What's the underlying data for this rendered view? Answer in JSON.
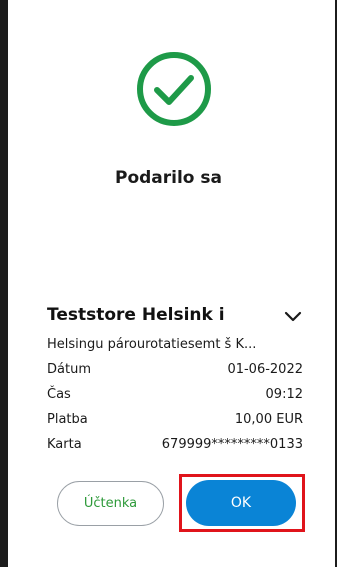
{
  "status": {
    "title": "Podarilo sa",
    "icon": "check-circle-icon",
    "color": "#1e9a48"
  },
  "merchant": {
    "name": "Teststore Helsink i",
    "address": "Helsingu párourotatiesemt š  K..."
  },
  "details": [
    {
      "label": "Dátum",
      "value": "01-06-2022"
    },
    {
      "label": "Čas",
      "value": "09:12"
    },
    {
      "label": "Platba",
      "value": "10,00 EUR"
    },
    {
      "label": "Karta",
      "value": "679999*********0133"
    }
  ],
  "buttons": {
    "receipt_label": "Účtenka",
    "ok_label": "OK"
  },
  "colors": {
    "ok_button": "#0a84d6",
    "receipt_text": "#2e9a3a",
    "highlight": "#e0141b"
  }
}
